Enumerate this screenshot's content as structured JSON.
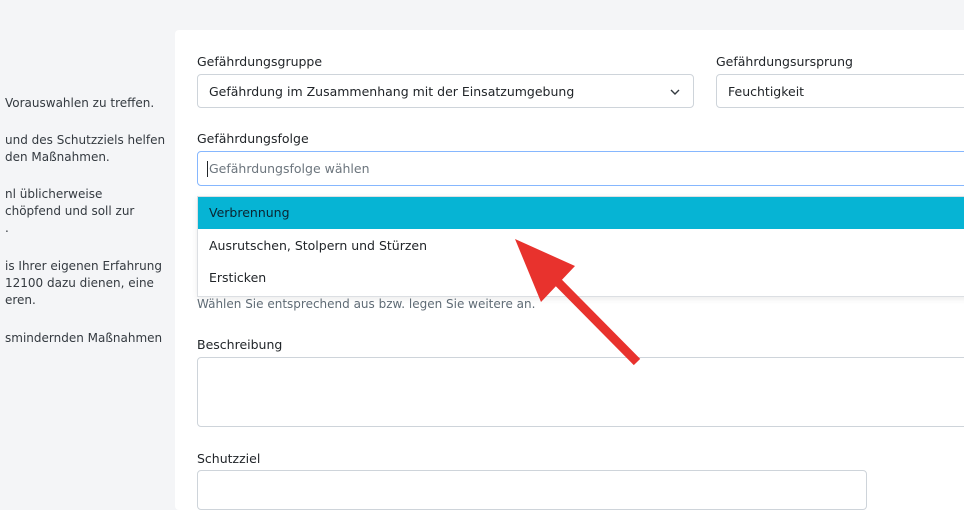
{
  "sidebar": {
    "lines": [
      "Vorauswahlen zu treffen.",
      "und des Schutzziels helfen",
      "den Maßnahmen.",
      "nl üblicherweise",
      "chöpfend und soll zur",
      ".",
      "is Ihrer eigenen Erfahrung",
      "12100 dazu dienen, eine",
      "eren.",
      "smindernden Maßnahmen"
    ]
  },
  "form": {
    "group_label": "Gefährdungsgruppe",
    "group_value": "Gefährdung im Zusammenhang mit der Einsatzumgebung",
    "origin_label": "Gefährdungsursprung",
    "origin_value": "Feuchtigkeit",
    "consequence_label": "Gefährdungsfolge",
    "consequence_placeholder": "Gefährdungsfolge wählen",
    "consequence_options": [
      "Verbrennung",
      "Ausrutschen, Stolpern und Stürzen",
      "Ersticken"
    ],
    "help_text": "Wählen Sie entsprechend aus bzw. legen Sie weitere an.",
    "description_label": "Beschreibung",
    "goal_label": "Schutzziel"
  },
  "colors": {
    "highlight": "#06b4d4",
    "arrow": "#e8322d"
  },
  "icons": {
    "select_chevron": "chevron-down-icon",
    "annotation_arrow": "arrow-icon"
  }
}
